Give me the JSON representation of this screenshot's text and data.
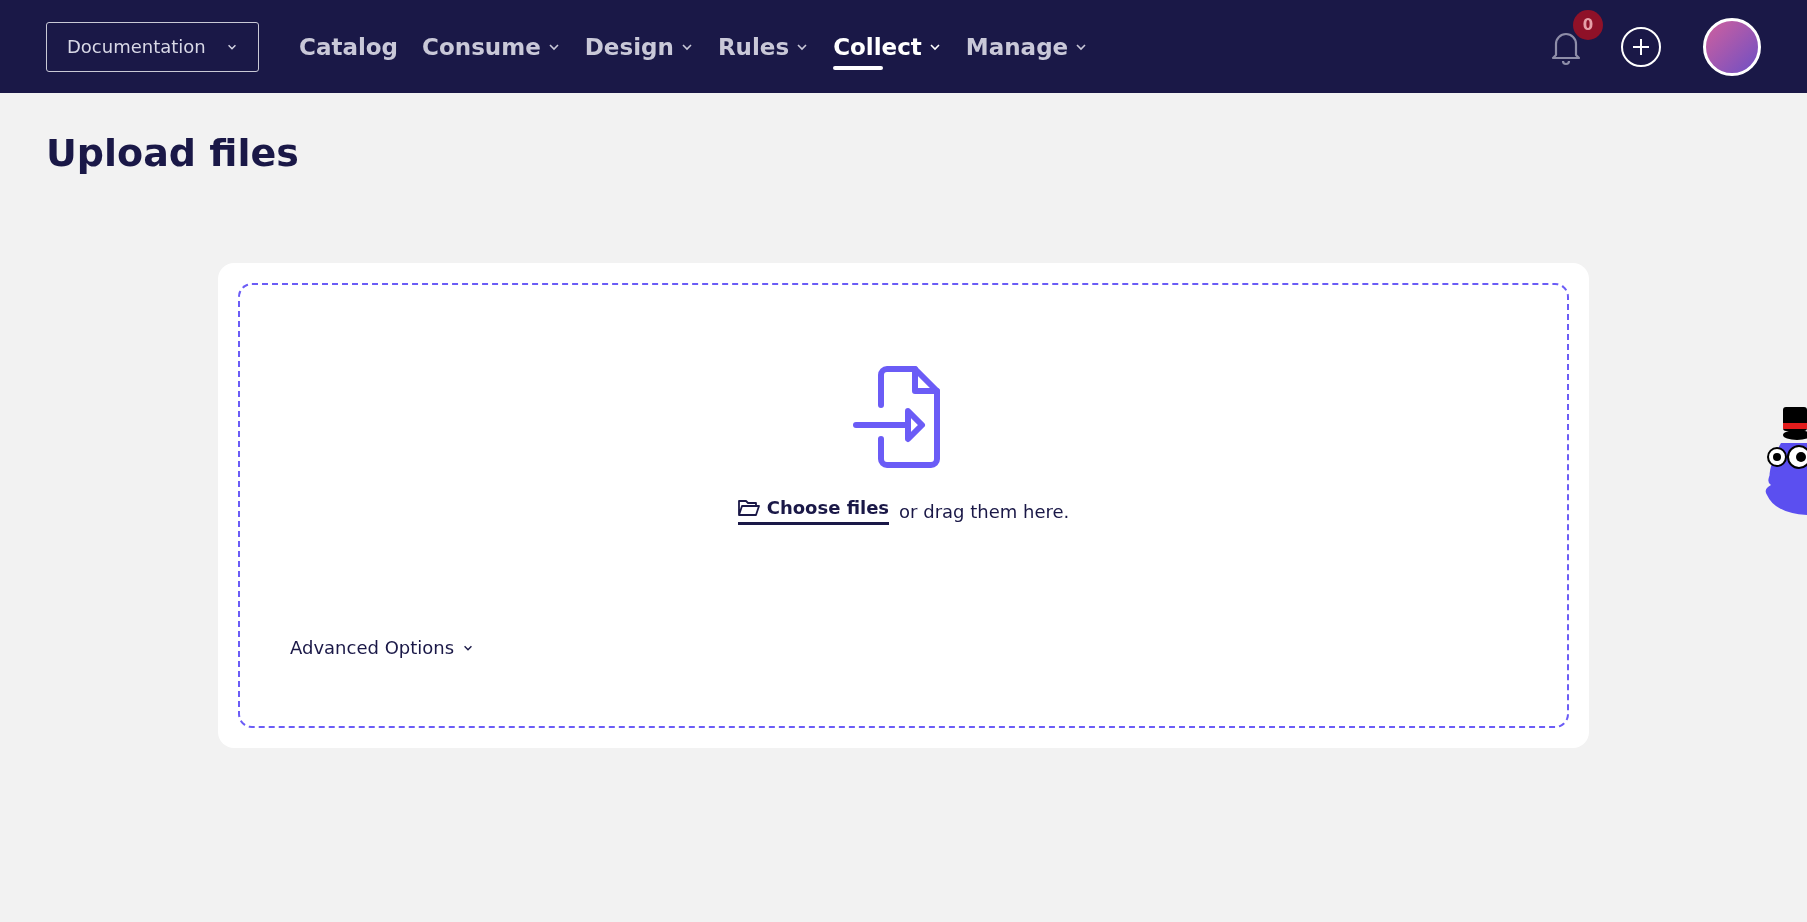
{
  "nav": {
    "workspace_select": {
      "value": "Documentation"
    },
    "items": [
      {
        "label": "Catalog",
        "has_menu": false,
        "selected": false
      },
      {
        "label": "Consume",
        "has_menu": true,
        "selected": false
      },
      {
        "label": "Design",
        "has_menu": true,
        "selected": false
      },
      {
        "label": "Rules",
        "has_menu": true,
        "selected": false
      },
      {
        "label": "Collect",
        "has_menu": true,
        "selected": true
      },
      {
        "label": "Manage",
        "has_menu": true,
        "selected": false
      }
    ],
    "notifications": {
      "count": "0"
    }
  },
  "page": {
    "title": "Upload files"
  },
  "upload": {
    "choose_link": "Choose files",
    "hint": "or drag them here.",
    "advanced_options": {
      "label": "Advanced Options",
      "expanded": false
    }
  }
}
